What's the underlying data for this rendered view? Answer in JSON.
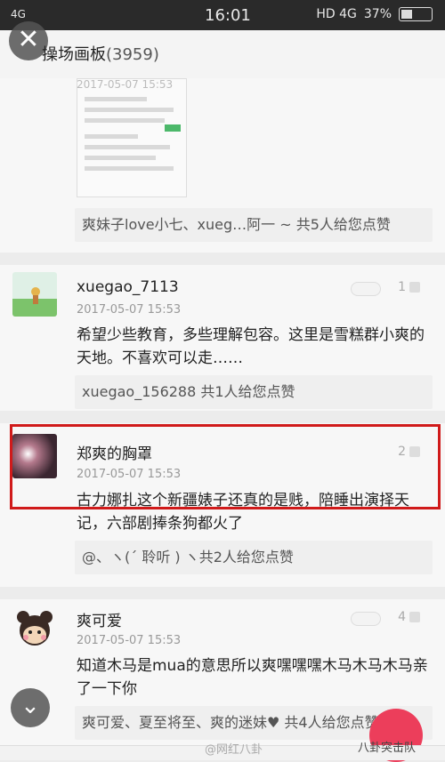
{
  "status": {
    "signal": "4G",
    "time": "16:01",
    "network": "HD 4G",
    "battery": "37%"
  },
  "header": {
    "title": "操场画板",
    "count": "(3959)"
  },
  "posts": [
    {
      "date": "2017-05-07 15:53",
      "likes": "爽妹子love小七、xueg…阿一 ~ 共5人给您点赞"
    },
    {
      "username": "xuegao_7113",
      "date": "2017-05-07 15:53",
      "text": "希望少些教育，多些理解包容。这里是雪糕群小爽的天地。不喜欢可以走……",
      "like_count": "1",
      "likes": "xuegao_156288 共1人给您点赞"
    },
    {
      "username": "郑爽的胸罩",
      "date": "2017-05-07 15:53",
      "text": "古力娜扎这个新疆婊子还真的是贱，陪睡出演择天记，六部剧捧条狗都火了",
      "like_count": "2",
      "likes": "@、ヽ(ˊ 聆听 ) ヽ共2人给您点赞"
    },
    {
      "username": "爽可爱",
      "date": "2017-05-07 15:53",
      "text": "知道木马是mua的意思所以爽嘿嘿嘿木马木马木马亲了一下你",
      "like_count": "4",
      "likes": "爽可爱、夏至将至、爽的迷妹♥ 共4人给您点赞"
    }
  ],
  "watermark": {
    "weibo": "@网红八卦",
    "wechat": "八卦突击队"
  }
}
